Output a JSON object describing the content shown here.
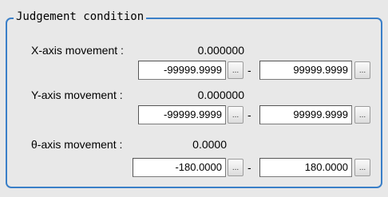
{
  "group": {
    "title": "Judgement condition"
  },
  "rows": [
    {
      "label": "X-axis movement :",
      "value": "0.000000",
      "min": "-99999.9999",
      "max": "99999.9999"
    },
    {
      "label": "Y-axis movement :",
      "value": "0.000000",
      "min": "-99999.9999",
      "max": "99999.9999"
    },
    {
      "label": "θ-axis movement :",
      "value": "0.0000",
      "min": "-180.0000",
      "max": "180.0000"
    }
  ],
  "button_label": "...",
  "separator": "-"
}
